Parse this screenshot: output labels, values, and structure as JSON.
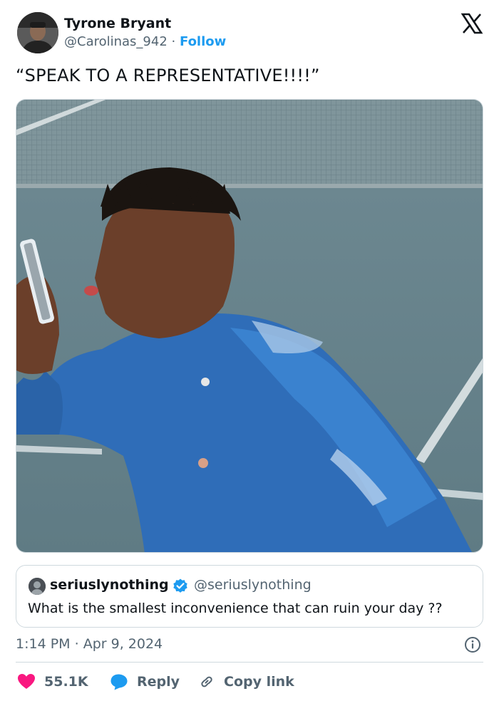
{
  "author": {
    "name": "Tyrone Bryant",
    "handle": "@Carolinas_942",
    "separator": "·",
    "follow_label": "Follow",
    "avatar_icon": "user-avatar"
  },
  "brand": {
    "logo": "x-logo"
  },
  "tweet": {
    "text": "“SPEAK TO A REPRESENTATIVE!!!!”",
    "media": {
      "kind": "photo"
    }
  },
  "quoted_tweet": {
    "name": "seriuslynothing",
    "handle": "@seriuslynothing",
    "text": "What is the smallest inconvenience that can ruin your day ??",
    "verified_icon": "verified-badge-icon"
  },
  "meta": {
    "time": "1:14 PM",
    "separator": "·",
    "date": "Apr 9, 2024"
  },
  "actions": {
    "likes": "55.1K",
    "reply_label": "Reply",
    "copy_link_label": "Copy link"
  },
  "colors": {
    "accent": "#1d9bf0",
    "like": "#f91880",
    "secondary_text": "#536471",
    "border": "#cfd9de"
  }
}
